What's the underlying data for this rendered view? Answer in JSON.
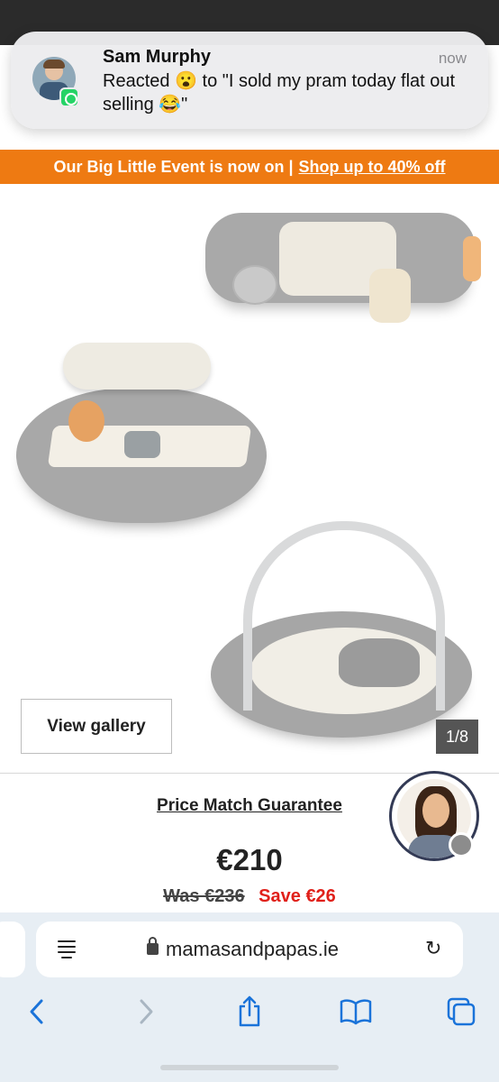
{
  "notification": {
    "sender": "Sam Murphy",
    "time": "now",
    "message": "Reacted 😮 to \"I sold my pram today flat out selling 😂\"",
    "app_icon": "whatsapp-icon"
  },
  "promo_banner": {
    "text": "Our Big Little Event is now on |",
    "link": "Shop up to 40% off",
    "background_color": "#ee7a12"
  },
  "gallery": {
    "view_gallery_label": "View gallery",
    "counter": "1/8"
  },
  "product": {
    "price_match_label": "Price Match Guarantee",
    "price": "€210",
    "was_price": "Was €236",
    "save_text": "Save €26",
    "save_color": "#e0201a"
  },
  "browser": {
    "url": "mamasandpapas.ie",
    "icons": [
      "reader-icon",
      "lock-icon",
      "reload-icon",
      "back-icon",
      "forward-icon",
      "share-icon",
      "bookmarks-icon",
      "tabs-icon"
    ],
    "accent_color": "#1a73d9"
  }
}
